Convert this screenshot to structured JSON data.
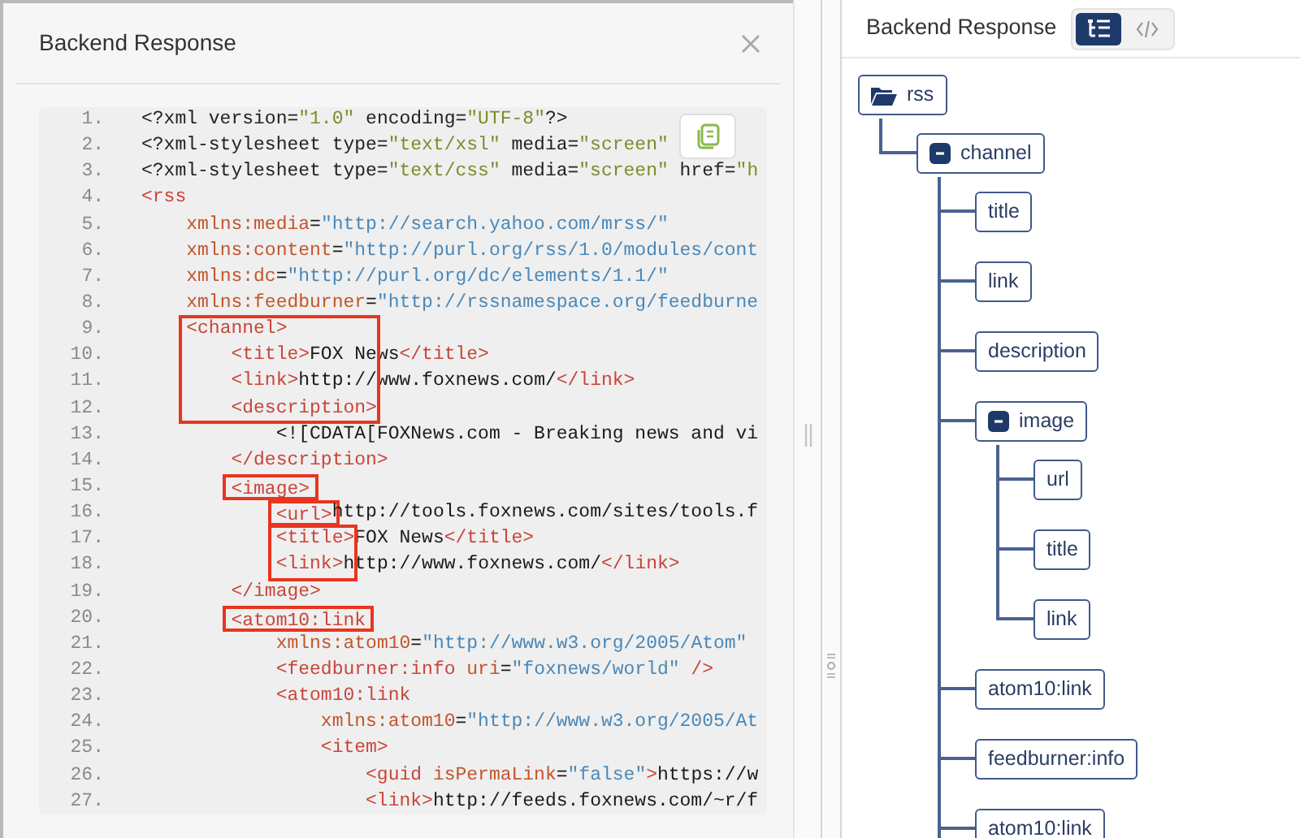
{
  "response_dialog": {
    "title": "Backend Response",
    "code": [
      {
        "kind": "line",
        "number": "1.",
        "tokens": [
          {
            "kind": "decl",
            "text": "<?xml version="
          },
          {
            "kind": "decl_value",
            "text": "\"1.0\""
          },
          {
            "kind": "decl",
            "text": " encoding="
          },
          {
            "kind": "decl_value",
            "text": "\"UTF-8\""
          },
          {
            "kind": "decl",
            "text": "?>"
          }
        ]
      },
      {
        "kind": "line",
        "number": "2.",
        "tokens": [
          {
            "kind": "decl",
            "text": "<?xml-stylesheet type="
          },
          {
            "kind": "decl_value",
            "text": "\"text/xsl\""
          },
          {
            "kind": "decl",
            "text": " media="
          },
          {
            "kind": "decl_value",
            "text": "\"screen\""
          }
        ]
      },
      {
        "kind": "line",
        "number": "3.",
        "tokens": [
          {
            "kind": "decl",
            "text": "<?xml-stylesheet type="
          },
          {
            "kind": "decl_value",
            "text": "\"text/css\""
          },
          {
            "kind": "decl",
            "text": " media="
          },
          {
            "kind": "decl_value",
            "text": "\"screen\""
          },
          {
            "kind": "decl",
            "text": " href="
          },
          {
            "kind": "decl_value",
            "text": "\"h"
          }
        ]
      },
      {
        "kind": "line",
        "number": "4.",
        "tokens": [
          {
            "kind": "tag",
            "text": "<rss"
          }
        ]
      },
      {
        "kind": "line",
        "number": "5.",
        "tokens": [
          {
            "kind": "attr",
            "text": "    xmlns:media"
          },
          {
            "kind": "text",
            "text": "="
          },
          {
            "kind": "value",
            "text": "\"http://search.yahoo.com/mrss/\""
          }
        ]
      },
      {
        "kind": "line",
        "number": "6.",
        "tokens": [
          {
            "kind": "attr",
            "text": "    xmlns:content"
          },
          {
            "kind": "text",
            "text": "="
          },
          {
            "kind": "value",
            "text": "\"http://purl.org/rss/1.0/modules/cont"
          }
        ]
      },
      {
        "kind": "line",
        "number": "7.",
        "tokens": [
          {
            "kind": "attr",
            "text": "    xmlns:dc"
          },
          {
            "kind": "text",
            "text": "="
          },
          {
            "kind": "value",
            "text": "\"http://purl.org/dc/elements/1.1/\""
          }
        ]
      },
      {
        "kind": "line",
        "number": "8.",
        "tokens": [
          {
            "kind": "attr",
            "text": "    xmlns:feedburner"
          },
          {
            "kind": "text",
            "text": "="
          },
          {
            "kind": "value",
            "text": "\"http://rssnamespace.org/feedburne"
          }
        ]
      },
      {
        "kind": "highlight",
        "lines": [
          {
            "number": "9.",
            "tokens": [
              {
                "kind": "tag",
                "text": "    <channel>"
              }
            ]
          },
          {
            "number": "10.",
            "tokens": [
              {
                "kind": "tag",
                "text": "        <title>"
              },
              {
                "kind": "text",
                "text": "FOX News"
              },
              {
                "kind": "tag",
                "text": "</title>"
              }
            ]
          },
          {
            "number": "11.",
            "tokens": [
              {
                "kind": "tag",
                "text": "        <link>"
              },
              {
                "kind": "text",
                "text": "http://www.foxnews.com/"
              },
              {
                "kind": "tag",
                "text": "</link>"
              }
            ]
          },
          {
            "number": "12.",
            "tokens": [
              {
                "kind": "tag",
                "text": "        <description>"
              }
            ]
          }
        ]
      },
      {
        "kind": "line",
        "number": "13.",
        "tokens": [
          {
            "kind": "text",
            "text": "            <![CDATA[FOXNews.com - Breaking news and vi"
          }
        ]
      },
      {
        "kind": "line",
        "number": "14.",
        "tokens": [
          {
            "kind": "tag",
            "text": "        </description>"
          }
        ]
      },
      {
        "kind": "highlight",
        "lines": [
          {
            "number": "15.",
            "tokens": [
              {
                "kind": "tag",
                "text": "        <image>"
              }
            ]
          }
        ]
      },
      {
        "kind": "highlight",
        "lines": [
          {
            "number": "16.",
            "tokens": [
              {
                "kind": "tag",
                "text": "            <url>"
              },
              {
                "kind": "text",
                "text": "http://tools.foxnews.com/sites/tools.f"
              }
            ]
          }
        ]
      },
      {
        "kind": "highlight",
        "lines": [
          {
            "number": "17.",
            "tokens": [
              {
                "kind": "tag",
                "text": "            <title>"
              },
              {
                "kind": "text",
                "text": "FOX News"
              },
              {
                "kind": "tag",
                "text": "</title>"
              }
            ]
          },
          {
            "number": "18.",
            "tokens": [
              {
                "kind": "tag",
                "text": "            <link>"
              },
              {
                "kind": "text",
                "text": "http://www.foxnews.com/"
              },
              {
                "kind": "tag",
                "text": "</link>"
              }
            ]
          }
        ]
      },
      {
        "kind": "line",
        "number": "19.",
        "tokens": [
          {
            "kind": "tag",
            "text": "        </image>"
          }
        ]
      },
      {
        "kind": "highlight",
        "lines": [
          {
            "number": "20.",
            "tokens": [
              {
                "kind": "tag",
                "text": "        <atom10:link"
              }
            ]
          }
        ]
      },
      {
        "kind": "line",
        "number": "21.",
        "tokens": [
          {
            "kind": "attr",
            "text": "            xmlns:atom10"
          },
          {
            "kind": "text",
            "text": "="
          },
          {
            "kind": "value",
            "text": "\"http://www.w3.org/2005/Atom\""
          }
        ]
      },
      {
        "kind": "line",
        "number": "22.",
        "tokens": [
          {
            "kind": "tag",
            "text": "            <feedburner:info"
          },
          {
            "kind": "attr",
            "text": " uri"
          },
          {
            "kind": "text",
            "text": "="
          },
          {
            "kind": "value",
            "text": "\"foxnews/world\""
          },
          {
            "kind": "tag",
            "text": " />"
          }
        ]
      },
      {
        "kind": "line",
        "number": "23.",
        "tokens": [
          {
            "kind": "tag",
            "text": "            <atom10:link"
          }
        ]
      },
      {
        "kind": "line",
        "number": "24.",
        "tokens": [
          {
            "kind": "attr",
            "text": "                xmlns:atom10"
          },
          {
            "kind": "text",
            "text": "="
          },
          {
            "kind": "value",
            "text": "\"http://www.w3.org/2005/At"
          }
        ]
      },
      {
        "kind": "line",
        "number": "25.",
        "tokens": [
          {
            "kind": "tag",
            "text": "                <item>"
          }
        ]
      },
      {
        "kind": "line",
        "number": "26.",
        "tokens": [
          {
            "kind": "tag",
            "text": "                    <guid"
          },
          {
            "kind": "attr",
            "text": " isPermaLink"
          },
          {
            "kind": "text",
            "text": "="
          },
          {
            "kind": "value",
            "text": "\"false\""
          },
          {
            "kind": "tag",
            "text": ">"
          },
          {
            "kind": "text",
            "text": "https://w"
          }
        ]
      },
      {
        "kind": "line",
        "number": "27.",
        "tokens": [
          {
            "kind": "tag",
            "text": "                    <link>"
          },
          {
            "kind": "text",
            "text": "http://feeds.foxnews.com/~r/f"
          }
        ]
      }
    ]
  },
  "tree_panel": {
    "title": "Backend Response",
    "view_modes": [
      {
        "kind": "tree",
        "selected": true
      },
      {
        "kind": "code",
        "selected": false
      }
    ],
    "tree": {
      "label": "rss",
      "kind": "root",
      "children": [
        {
          "label": "channel",
          "kind": "branch",
          "expanded": true,
          "continues_below": true,
          "children": [
            {
              "label": "title",
              "kind": "leaf"
            },
            {
              "label": "link",
              "kind": "leaf"
            },
            {
              "label": "description",
              "kind": "leaf"
            },
            {
              "label": "image",
              "kind": "branch",
              "expanded": true,
              "children": [
                {
                  "label": "url",
                  "kind": "leaf"
                },
                {
                  "label": "title",
                  "kind": "leaf"
                },
                {
                  "label": "link",
                  "kind": "leaf"
                }
              ]
            },
            {
              "label": "atom10:link",
              "kind": "leaf"
            },
            {
              "label": "feedburner:info",
              "kind": "leaf"
            },
            {
              "label": "atom10:link",
              "kind": "leaf"
            }
          ]
        }
      ]
    }
  }
}
